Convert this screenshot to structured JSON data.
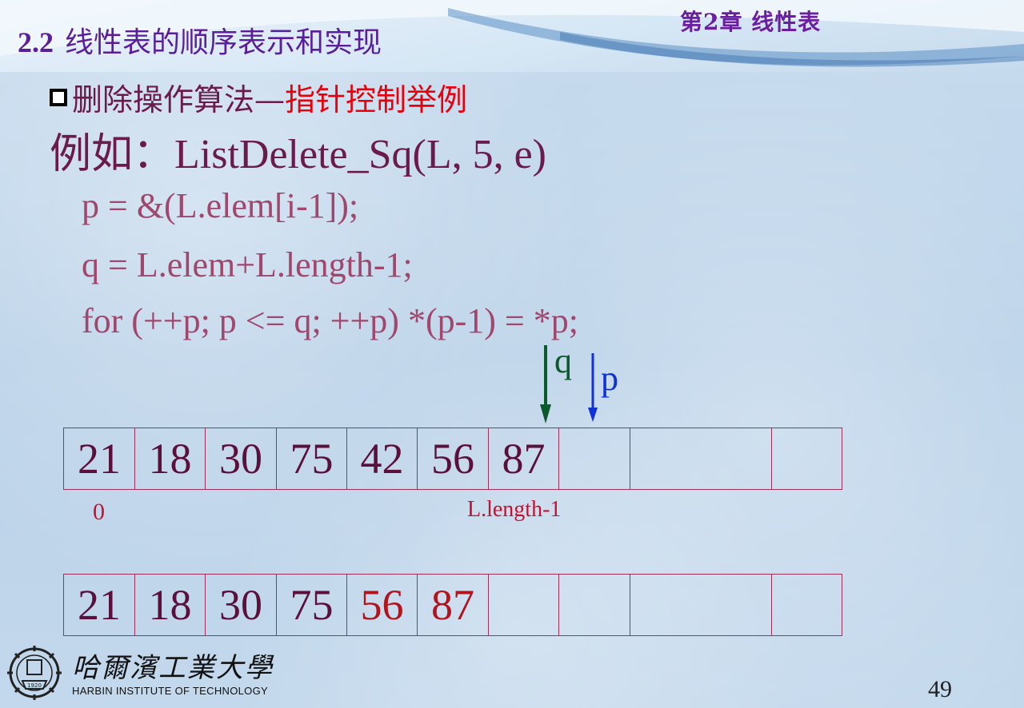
{
  "chapter": "第2章  线性表",
  "section": {
    "number": "2.2",
    "title": "线性表的顺序表示和实现"
  },
  "bullet": {
    "part1": "删除操作算法—",
    "part2": "指针控制举例"
  },
  "example": {
    "prefix": "例如：",
    "call": "ListDelete_Sq(L, 5, e)"
  },
  "code": [
    "p = &(L.elem[i-1]);",
    "q = L.elem+L.length-1;",
    "for (++p; p <= q; ++p)  *(p-1) = *p;"
  ],
  "pointers": {
    "q": {
      "label": "q",
      "color": "#0b5a2c",
      "cell_index": 6
    },
    "p": {
      "label": "p",
      "color": "#1030d8",
      "cell_index": 7
    }
  },
  "array_before": [
    "21",
    "18",
    "30",
    "75",
    "42",
    "56",
    "87",
    "",
    "",
    ""
  ],
  "array_after": [
    "21",
    "18",
    "30",
    "75",
    "56",
    "87",
    "",
    "",
    "",
    ""
  ],
  "array_after_highlight": [
    4,
    5
  ],
  "index_labels": {
    "start": "0",
    "end": "L.length-1"
  },
  "logo": {
    "cn": "哈爾濱工業大學",
    "en": "HARBIN INSTITUTE OF TECHNOLOGY",
    "seal_year": "1920"
  },
  "page_number": "49"
}
